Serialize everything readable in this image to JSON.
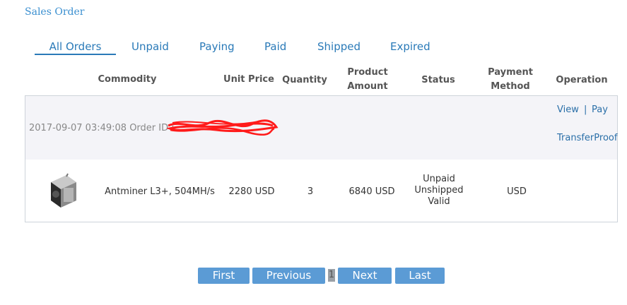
{
  "page_title": "Sales Order",
  "tabs": [
    "All Orders",
    "Unpaid",
    "Paying",
    "Paid",
    "Shipped",
    "Expired"
  ],
  "columns": {
    "commodity": "Commodity",
    "unit_price": "Unit Price",
    "quantity": "Quantity",
    "product_amount_line1": "Product",
    "product_amount_line2": "Amount",
    "status": "Status",
    "payment_method_line1": "Payment",
    "payment_method_line2": "Method",
    "operation": "Operation"
  },
  "order": {
    "meta": "2017-09-07 03:49:08 Order ID :",
    "ops": {
      "view": "View",
      "sep": "|",
      "pay": "Pay",
      "transfer": "TransferProof"
    },
    "item": {
      "name": "Antminer L3+, 504MH/s",
      "unit_price": "2280  USD",
      "quantity": "3",
      "amount": "6840  USD",
      "status_1": "Unpaid",
      "status_2": "Unshipped",
      "status_3": "Valid",
      "payment_method": "USD"
    }
  },
  "pager": {
    "first": "First",
    "previous": "Previous",
    "current": "1",
    "next": "Next",
    "last": "Last"
  },
  "colors": {
    "accent": "#2a7ab8",
    "button": "#5b9bd5",
    "redaction": "#ff1a1a"
  },
  "icons": {
    "product": "antminer-thumbnail"
  }
}
